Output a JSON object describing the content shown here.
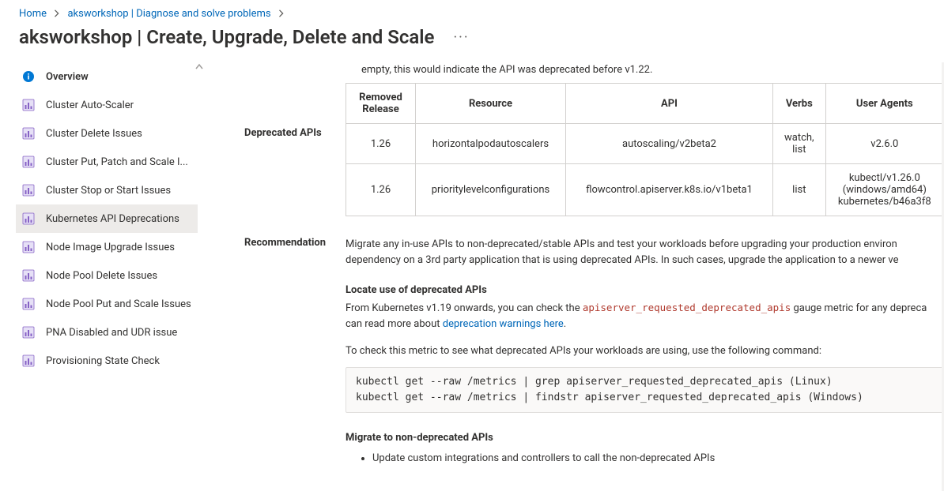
{
  "breadcrumb": {
    "home": "Home",
    "second": "aksworkshop | Diagnose and solve problems"
  },
  "page_title": "aksworkshop | Create, Upgrade, Delete and Scale",
  "sidebar": {
    "items": [
      {
        "label": "Overview",
        "icon": "info"
      },
      {
        "label": "Cluster Auto-Scaler",
        "icon": "bar"
      },
      {
        "label": "Cluster Delete Issues",
        "icon": "bar"
      },
      {
        "label": "Cluster Put, Patch and Scale I...",
        "icon": "bar"
      },
      {
        "label": "Cluster Stop or Start Issues",
        "icon": "bar"
      },
      {
        "label": "Kubernetes API Deprecations",
        "icon": "bar"
      },
      {
        "label": "Node Image Upgrade Issues",
        "icon": "bar"
      },
      {
        "label": "Node Pool Delete Issues",
        "icon": "bar"
      },
      {
        "label": "Node Pool Put and Scale Issues",
        "icon": "bar"
      },
      {
        "label": "PNA Disabled and UDR issue",
        "icon": "bar"
      },
      {
        "label": "Provisioning State Check",
        "icon": "bar"
      }
    ],
    "selected_index": 5
  },
  "content": {
    "intro_fragment": "empty, this would indicate the API was deprecated before v1.22.",
    "deprecated_label": "Deprecated APIs",
    "table": {
      "headers": [
        "Removed Release",
        "Resource",
        "API",
        "Verbs",
        "User Agents"
      ],
      "rows": [
        {
          "release": "1.26",
          "resource": "horizontalpodautoscalers",
          "api": "autoscaling/v2beta2",
          "verbs": "watch, list",
          "ua": "v2.6.0"
        },
        {
          "release": "1.26",
          "resource": "prioritylevelconfigurations",
          "api": "flowcontrol.apiserver.k8s.io/v1beta1",
          "verbs": "list",
          "ua": "kubectl/v1.26.0 (windows/amd64) kubernetes/b46a3f8"
        }
      ]
    },
    "recommendation_label": "Recommendation",
    "recommendation_text1": "Migrate any in-use APIs to non-deprecated/stable APIs and test your workloads before upgrading your production environ",
    "recommendation_text2": "dependency on a 3rd party application that is using deprecated APIs. In such cases, upgrade the application to a newer ve",
    "locate_heading": "Locate use of deprecated APIs",
    "locate_line_prefix": "From Kubernetes v1.19 onwards, you can check the ",
    "locate_metric": "apiserver_requested_deprecated_apis",
    "locate_line_suffix": " gauge metric for any depreca",
    "locate_line2_prefix": "can read more about ",
    "locate_link_text": "deprecation warnings here",
    "locate_line2_suffix": ".",
    "check_line": "To check this metric to see what deprecated APIs your workloads are using, use the following command:",
    "code_line1": "kubectl get --raw /metrics | grep apiserver_requested_deprecated_apis (Linux)",
    "code_line2": "kubectl get --raw /metrics | findstr apiserver_requested_deprecated_apis (Windows)",
    "migrate_heading": "Migrate to non-deprecated APIs",
    "bullet1": "Update custom integrations and controllers to call the non-deprecated APIs"
  }
}
